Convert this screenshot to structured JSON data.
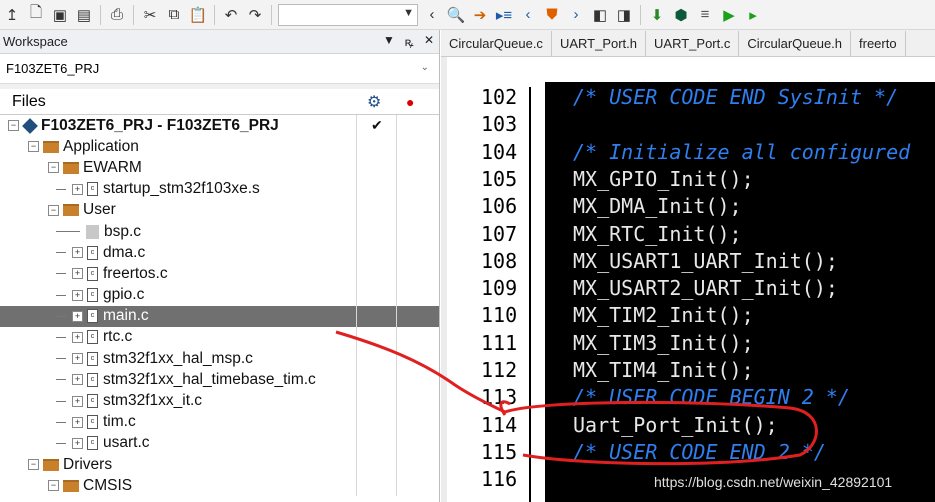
{
  "toolbar": {
    "icons": [
      "insert-icon",
      "new-file-icon",
      "save-icon",
      "save-all-icon",
      "print-icon",
      "cut-icon",
      "copy-icon",
      "paste-icon",
      "undo-icon",
      "redo-icon",
      "search-combo",
      "back-icon",
      "find-icon",
      "goto-icon",
      "bookmark-icon",
      "prev-icon",
      "shield-icon",
      "next-icon",
      "file-left-icon",
      "file-right-icon",
      "download-icon",
      "chip-icon",
      "list-icon",
      "go-icon",
      "debug-icon"
    ]
  },
  "workspace": {
    "title": "Workspace",
    "ctl_down": "▼",
    "ctl_pin": "ꝶ",
    "ctl_close": "✕",
    "project_select": "F103ZET6_PRJ",
    "files_label": "Files"
  },
  "tree": [
    {
      "label": "F103ZET6_PRJ - F103ZET6_PRJ",
      "level": 0,
      "kind": "project",
      "bold": true
    },
    {
      "label": "Application",
      "level": 1,
      "kind": "folder"
    },
    {
      "label": "EWARM",
      "level": 2,
      "kind": "folder"
    },
    {
      "label": "startup_stm32f103xe.s",
      "level": 3,
      "kind": "file"
    },
    {
      "label": "User",
      "level": 2,
      "kind": "folder"
    },
    {
      "label": "bsp.c",
      "level": 3,
      "kind": "greyfile"
    },
    {
      "label": "dma.c",
      "level": 3,
      "kind": "file"
    },
    {
      "label": "freertos.c",
      "level": 3,
      "kind": "file"
    },
    {
      "label": "gpio.c",
      "level": 3,
      "kind": "file"
    },
    {
      "label": "main.c",
      "level": 3,
      "kind": "file",
      "selected": true
    },
    {
      "label": "rtc.c",
      "level": 3,
      "kind": "file"
    },
    {
      "label": "stm32f1xx_hal_msp.c",
      "level": 3,
      "kind": "file"
    },
    {
      "label": "stm32f1xx_hal_timebase_tim.c",
      "level": 3,
      "kind": "file"
    },
    {
      "label": "stm32f1xx_it.c",
      "level": 3,
      "kind": "file"
    },
    {
      "label": "tim.c",
      "level": 3,
      "kind": "file"
    },
    {
      "label": "usart.c",
      "level": 3,
      "kind": "file"
    },
    {
      "label": "Drivers",
      "level": 1,
      "kind": "folder"
    },
    {
      "label": "CMSIS",
      "level": 2,
      "kind": "folder"
    }
  ],
  "tabs": [
    "CircularQueue.c",
    "UART_Port.h",
    "UART_Port.c",
    "CircularQueue.h",
    "freerto"
  ],
  "editor": {
    "lines": [
      {
        "n": "102",
        "text": "/* USER CODE END SysInit */",
        "cls": "cmt"
      },
      {
        "n": "103",
        "text": "",
        "cls": "nrm"
      },
      {
        "n": "104",
        "text": "/* Initialize all configured",
        "cls": "cmt"
      },
      {
        "n": "105",
        "text": "MX_GPIO_Init();",
        "cls": "nrm"
      },
      {
        "n": "106",
        "text": "MX_DMA_Init();",
        "cls": "nrm"
      },
      {
        "n": "107",
        "text": "MX_RTC_Init();",
        "cls": "nrm"
      },
      {
        "n": "108",
        "text": "MX_USART1_UART_Init();",
        "cls": "nrm"
      },
      {
        "n": "109",
        "text": "MX_USART2_UART_Init();",
        "cls": "nrm"
      },
      {
        "n": "110",
        "text": "MX_TIM2_Init();",
        "cls": "nrm"
      },
      {
        "n": "111",
        "text": "MX_TIM3_Init();",
        "cls": "nrm"
      },
      {
        "n": "112",
        "text": "MX_TIM4_Init();",
        "cls": "nrm"
      },
      {
        "n": "113",
        "text": "/* USER CODE BEGIN 2 */",
        "cls": "cmt"
      },
      {
        "n": "114",
        "text": "Uart_Port_Init();",
        "cls": "nrm"
      },
      {
        "n": "115",
        "text": "/* USER CODE END 2 */",
        "cls": "cmt"
      },
      {
        "n": "116",
        "text": "",
        "cls": "nrm"
      }
    ]
  },
  "watermark": "https://blog.csdn.net/weixin_42892101",
  "annotation_color": "#e02020"
}
